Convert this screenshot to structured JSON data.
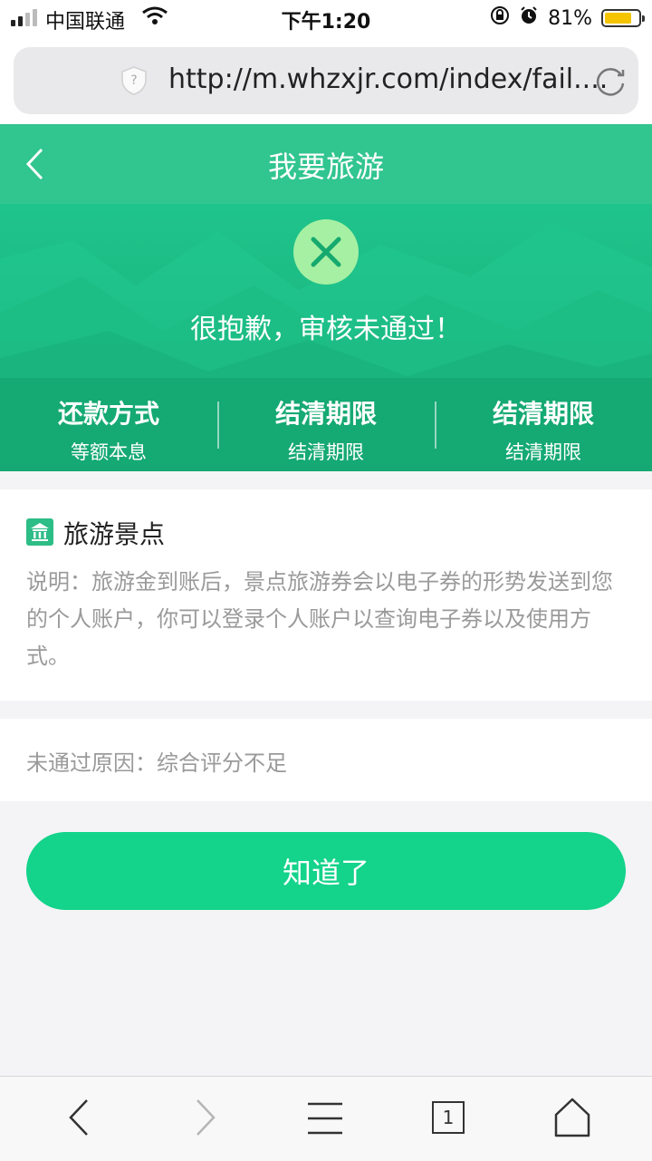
{
  "status_bar": {
    "carrier": "中国联通",
    "time": "下午1:20",
    "battery": "81%",
    "battery_level": 0.81
  },
  "browser": {
    "url": "http://m.whzxjr.com/index/fail...."
  },
  "header": {
    "title": "我要旅游"
  },
  "result": {
    "message": "很抱歉，审核未通过！"
  },
  "terms": [
    {
      "label": "还款方式",
      "value": "等额本息"
    },
    {
      "label": "结清期限",
      "value": "结清期限"
    },
    {
      "label": "结清期限",
      "value": "结清期限"
    }
  ],
  "section": {
    "title": "旅游景点",
    "description": "说明：旅游金到账后，景点旅游券会以电子券的形势发送到您的个人账户，你可以登录个人账户以查询电子券以及使用方式。"
  },
  "reason": "未通过原因：综合评分不足",
  "button": {
    "label": "知道了"
  },
  "toolbar": {
    "tab_count": "1"
  },
  "colors": {
    "header": "#31c58f",
    "hero": "#1ec48c",
    "button": "#14d38b",
    "fail_icon": "#a6f0a3"
  }
}
